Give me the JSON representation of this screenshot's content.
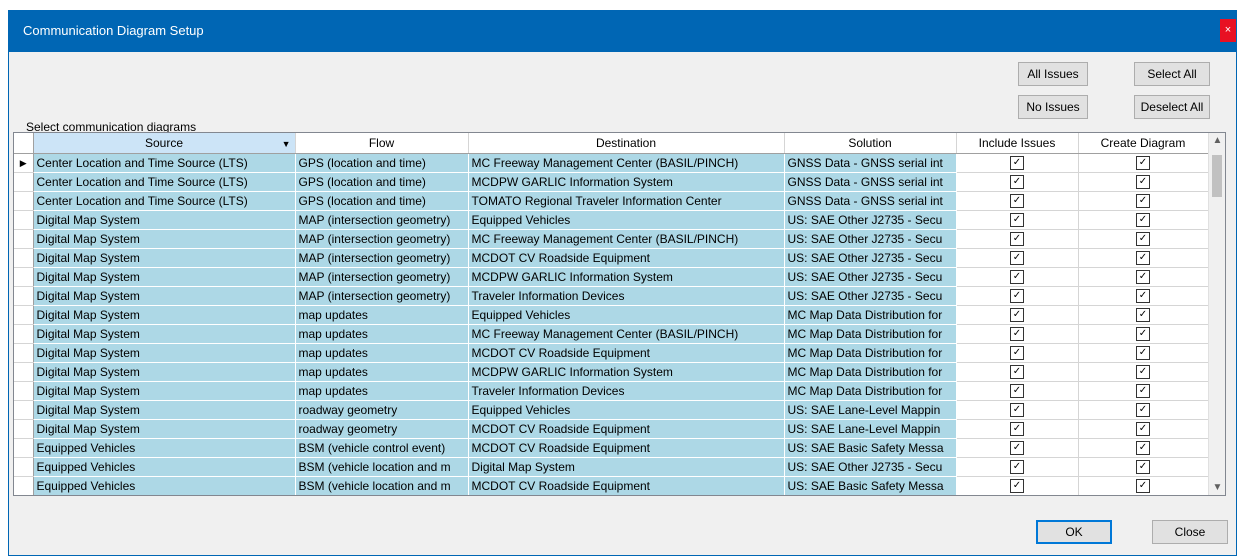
{
  "window": {
    "title": "Communication Diagram Setup",
    "close_glyph": "×"
  },
  "buttons": {
    "all_issues": "All Issues",
    "no_issues": "No Issues",
    "select_all": "Select All",
    "deselect_all": "Deselect All",
    "ok": "OK",
    "close": "Close"
  },
  "grid_label": "Select communication diagrams",
  "columns": [
    "Source",
    "Flow",
    "Destination",
    "Solution",
    "Include Issues",
    "Create Diagram"
  ],
  "rows": [
    {
      "source": "Center Location and Time Source (LTS)",
      "flow": "GPS (location and time)",
      "destination": "MC Freeway Management Center (BASIL/PINCH)",
      "solution": "GNSS Data - GNSS serial int",
      "include": true,
      "create": true
    },
    {
      "source": "Center Location and Time Source (LTS)",
      "flow": "GPS (location and time)",
      "destination": "MCDPW GARLIC Information System",
      "solution": "GNSS Data - GNSS serial int",
      "include": true,
      "create": true
    },
    {
      "source": "Center Location and Time Source (LTS)",
      "flow": "GPS (location and time)",
      "destination": "TOMATO Regional Traveler Information Center",
      "solution": "GNSS Data - GNSS serial int",
      "include": true,
      "create": true
    },
    {
      "source": "Digital Map System",
      "flow": "MAP (intersection geometry)",
      "destination": "Equipped Vehicles",
      "solution": "US: SAE Other J2735 - Secu",
      "include": true,
      "create": true
    },
    {
      "source": "Digital Map System",
      "flow": "MAP (intersection geometry)",
      "destination": "MC Freeway Management Center (BASIL/PINCH)",
      "solution": "US: SAE Other J2735 - Secu",
      "include": true,
      "create": true
    },
    {
      "source": "Digital Map System",
      "flow": "MAP (intersection geometry)",
      "destination": "MCDOT CV Roadside Equipment",
      "solution": "US: SAE Other J2735 - Secu",
      "include": true,
      "create": true
    },
    {
      "source": "Digital Map System",
      "flow": "MAP (intersection geometry)",
      "destination": "MCDPW GARLIC Information System",
      "solution": "US: SAE Other J2735 - Secu",
      "include": true,
      "create": true
    },
    {
      "source": "Digital Map System",
      "flow": "MAP (intersection geometry)",
      "destination": "Traveler Information Devices",
      "solution": "US: SAE Other J2735 - Secu",
      "include": true,
      "create": true
    },
    {
      "source": "Digital Map System",
      "flow": "map updates",
      "destination": "Equipped Vehicles",
      "solution": "MC Map Data Distribution for",
      "include": true,
      "create": true
    },
    {
      "source": "Digital Map System",
      "flow": "map updates",
      "destination": "MC Freeway Management Center (BASIL/PINCH)",
      "solution": "MC Map Data Distribution for",
      "include": true,
      "create": true
    },
    {
      "source": "Digital Map System",
      "flow": "map updates",
      "destination": "MCDOT CV Roadside Equipment",
      "solution": "MC Map Data Distribution for",
      "include": true,
      "create": true
    },
    {
      "source": "Digital Map System",
      "flow": "map updates",
      "destination": "MCDPW GARLIC Information System",
      "solution": "MC Map Data Distribution for",
      "include": true,
      "create": true
    },
    {
      "source": "Digital Map System",
      "flow": "map updates",
      "destination": "Traveler Information Devices",
      "solution": "MC Map Data Distribution for",
      "include": true,
      "create": true
    },
    {
      "source": "Digital Map System",
      "flow": "roadway geometry",
      "destination": "Equipped Vehicles",
      "solution": "US: SAE Lane-Level Mappin",
      "include": true,
      "create": true
    },
    {
      "source": "Digital Map System",
      "flow": "roadway geometry",
      "destination": "MCDOT CV Roadside Equipment",
      "solution": "US: SAE Lane-Level Mappin",
      "include": true,
      "create": true
    },
    {
      "source": "Equipped Vehicles",
      "flow": "BSM (vehicle control event)",
      "destination": "MCDOT CV Roadside Equipment",
      "solution": "US: SAE Basic Safety Messa",
      "include": true,
      "create": true
    },
    {
      "source": "Equipped Vehicles",
      "flow": "BSM (vehicle location and m",
      "destination": "Digital Map System",
      "solution": "US: SAE Other J2735 - Secu",
      "include": true,
      "create": true
    },
    {
      "source": "Equipped Vehicles",
      "flow": "BSM (vehicle location and m",
      "destination": "MCDOT CV Roadside Equipment",
      "solution": "US: SAE Basic Safety Messa",
      "include": true,
      "create": true
    }
  ],
  "current_row_glyph": "▶",
  "check_glyph": "✓",
  "scrollbar": {
    "up_glyph": "▲",
    "down_glyph": "▼"
  },
  "sort_glyph": "▼"
}
